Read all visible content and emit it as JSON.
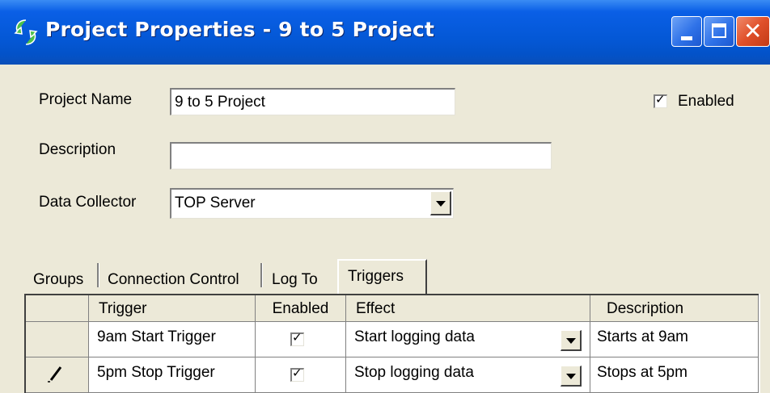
{
  "window": {
    "title": "Project Properties - 9 to 5 Project",
    "icon": "app-icon",
    "controls": [
      "minimize-icon",
      "maximize-icon",
      "close-icon"
    ]
  },
  "form": {
    "project_name_label": "Project Name",
    "project_name_value": "9 to 5 Project",
    "description_label": "Description",
    "description_value": "",
    "data_collector_label": "Data Collector",
    "data_collector_value": "TOP Server",
    "enabled_label": "Enabled",
    "enabled_checked": true
  },
  "tabs": [
    {
      "label": "Groups",
      "active": false
    },
    {
      "label": "Connection Control",
      "active": false
    },
    {
      "label": "Log To",
      "active": false
    },
    {
      "label": "Triggers",
      "active": true
    }
  ],
  "triggers_grid": {
    "columns": [
      "Trigger",
      "Enabled",
      "Effect",
      "Description"
    ],
    "rows": [
      {
        "trigger": "9am Start Trigger",
        "enabled": true,
        "effect": "Start logging data",
        "description": "Starts at 9am",
        "row_icon": ""
      },
      {
        "trigger": "5pm Stop Trigger",
        "enabled": true,
        "effect": "Stop logging data",
        "description": "Stops at 5pm",
        "row_icon": "pencil-edit-icon"
      }
    ]
  },
  "colors": {
    "title_bar": "#0458d6",
    "dialog_bg": "#ece9d8",
    "close_button": "#e0502a"
  }
}
